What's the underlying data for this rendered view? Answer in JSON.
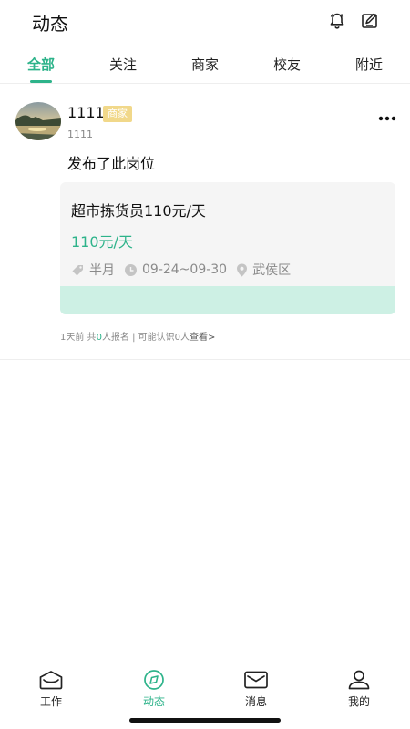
{
  "header": {
    "title": "动态",
    "icons": {
      "bell": "bell-icon",
      "edit": "edit-icon"
    }
  },
  "tabs": [
    {
      "label": "全部",
      "active": true
    },
    {
      "label": "关注",
      "active": false
    },
    {
      "label": "商家",
      "active": false
    },
    {
      "label": "校友",
      "active": false
    },
    {
      "label": "附近",
      "active": false
    }
  ],
  "post": {
    "username": "1111",
    "badge": "商家",
    "subname": "1111",
    "text": "发布了此岗位",
    "job": {
      "title": "超市拣货员110元/天",
      "salary": "110元/天",
      "period": "半月",
      "dates": "09-24~09-30",
      "district": "武侯区"
    },
    "footer": {
      "time": "1天前",
      "count_prefix": " 共",
      "count": "0",
      "count_suffix": "人报名",
      "separator": " | ",
      "known": "可能认识0人",
      "view": "查看>"
    }
  },
  "bottom_nav": [
    {
      "label": "工作",
      "icon": "work-icon",
      "active": false
    },
    {
      "label": "动态",
      "icon": "feed-icon",
      "active": true
    },
    {
      "label": "消息",
      "icon": "message-icon",
      "active": false
    },
    {
      "label": "我的",
      "icon": "profile-icon",
      "active": false
    }
  ],
  "colors": {
    "accent": "#2db38a",
    "badge": "#f1d88a",
    "band": "#cdf0e4"
  }
}
